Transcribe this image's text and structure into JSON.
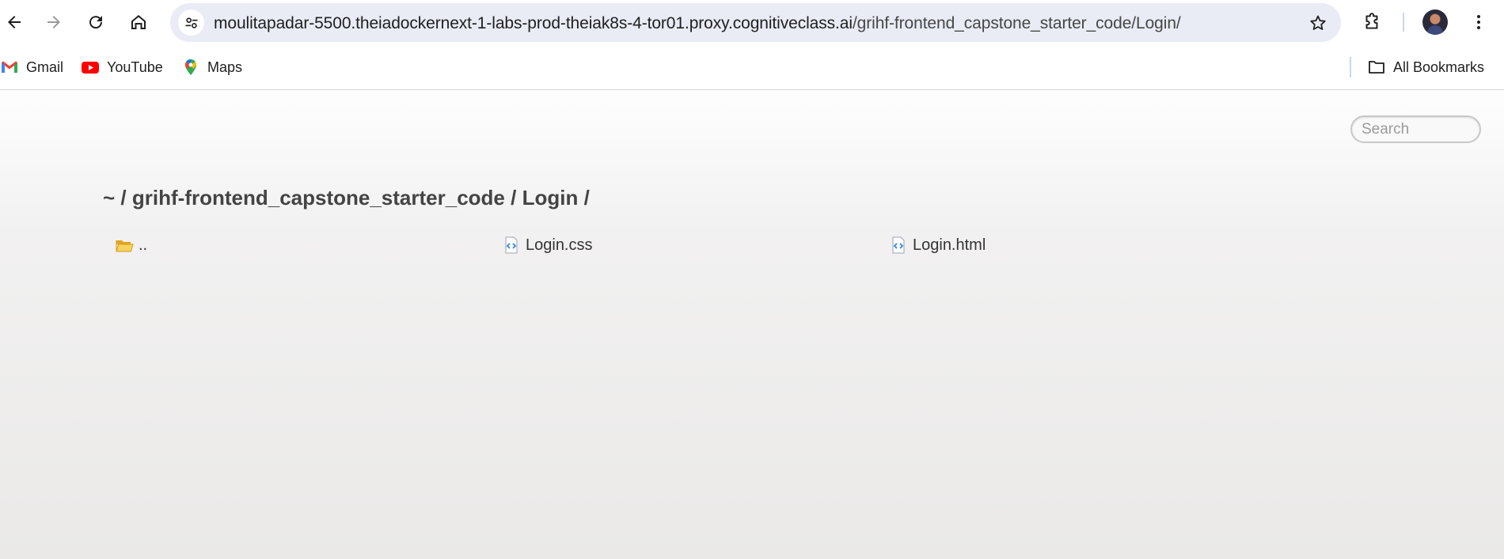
{
  "browser": {
    "url_host": "moulitapadar-5500.theiadockernext-1-labs-prod-theiak8s-4-tor01.proxy.cognitiveclass.ai",
    "url_path": "/grihf-frontend_capstone_starter_code/Login/",
    "icons": {
      "back": "back-arrow-icon",
      "forward": "forward-arrow-icon",
      "reload": "reload-icon",
      "home": "home-icon",
      "site_info": "tune-icon",
      "bookmark_star": "star-icon",
      "extensions": "puzzle-icon",
      "menu": "kebab-menu-icon"
    }
  },
  "bookmarks": {
    "items": [
      {
        "label": "Gmail",
        "icon": "gmail-icon"
      },
      {
        "label": "YouTube",
        "icon": "youtube-icon"
      },
      {
        "label": "Maps",
        "icon": "maps-icon"
      }
    ],
    "all_bookmarks_label": "All Bookmarks"
  },
  "page": {
    "search_placeholder": "Search",
    "breadcrumb": {
      "home": "~",
      "separator": "/",
      "folder": "grihf-frontend_capstone_starter_code",
      "subfolder": "Login"
    },
    "files": [
      {
        "name": "..",
        "type": "folder"
      },
      {
        "name": "Login.css",
        "type": "code-file"
      },
      {
        "name": "Login.html",
        "type": "code-file"
      }
    ]
  },
  "colors": {
    "omnibox": "#e9ecf5",
    "text": "#444444",
    "folder": "#f2c443",
    "code_icon": "#4a90d9"
  }
}
